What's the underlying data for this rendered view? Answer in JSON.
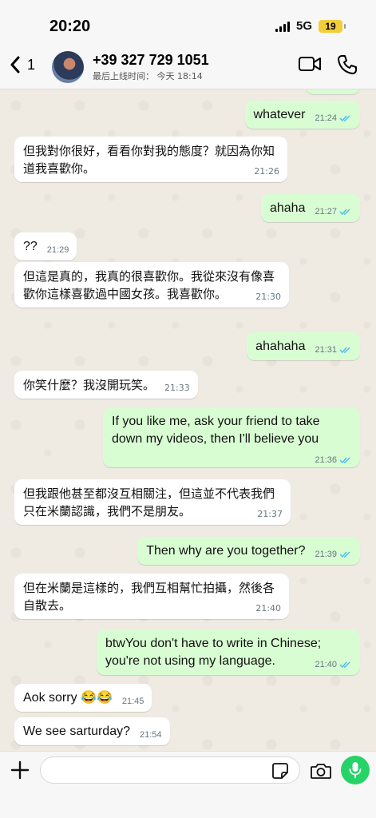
{
  "status_bar": {
    "time": "20:20",
    "network": "5G",
    "battery": "19"
  },
  "header": {
    "back_count": "1",
    "contact_name": "+39 327 729 1051",
    "last_seen": "最后上线时间： 今天 18:14"
  },
  "messages": [
    {
      "dir": "out",
      "text": "whatever",
      "time": "21:24"
    },
    {
      "dir": "in",
      "text": "但我對你很好，看看你對我的態度？就因為你知道我喜歡你。",
      "time": "21:26"
    },
    {
      "dir": "out",
      "text": "ahaha",
      "time": "21:27"
    },
    {
      "dir": "in",
      "text": "??",
      "time": "21:29"
    },
    {
      "dir": "in",
      "text": "但這是真的，我真的很喜歡你。我從來沒有像喜歡你這樣喜歡過中國女孩。我喜歡你。",
      "time": "21:30"
    },
    {
      "dir": "out",
      "text": "ahahaha",
      "time": "21:31"
    },
    {
      "dir": "in",
      "text": "你笑什麼？我沒開玩笑。",
      "time": "21:33"
    },
    {
      "dir": "out",
      "text": "If you like me, ask your friend to take down my videos, then I'll believe you",
      "time": "21:36"
    },
    {
      "dir": "in",
      "text": "但我跟他甚至都沒互相關注，但這並不代表我們只在米蘭認識，我們不是朋友。",
      "time": "21:37"
    },
    {
      "dir": "out",
      "text": "Then why are you together?",
      "time": "21:39"
    },
    {
      "dir": "in",
      "text": "但在米蘭是這樣的，我們互相幫忙拍攝，然後各自散去。",
      "time": "21:40"
    },
    {
      "dir": "out",
      "text": "btwYou don't have to write in Chinese; you're not using my language.",
      "time": "21:40"
    },
    {
      "dir": "in",
      "text": "Aok sorry 😂😂",
      "time": "21:45"
    },
    {
      "dir": "in",
      "text": "We see sarturday?",
      "time": "21:54"
    }
  ],
  "input": {
    "value": "",
    "placeholder": ""
  },
  "colors": {
    "outgoing": "#d9fdd3",
    "incoming": "#ffffff",
    "ticks": "#53bdeb",
    "mic": "#25d366"
  },
  "icons": [
    "back-chevron-icon",
    "video-call-icon",
    "phone-icon",
    "plus-icon",
    "sticker-icon",
    "camera-icon",
    "microphone-icon"
  ]
}
